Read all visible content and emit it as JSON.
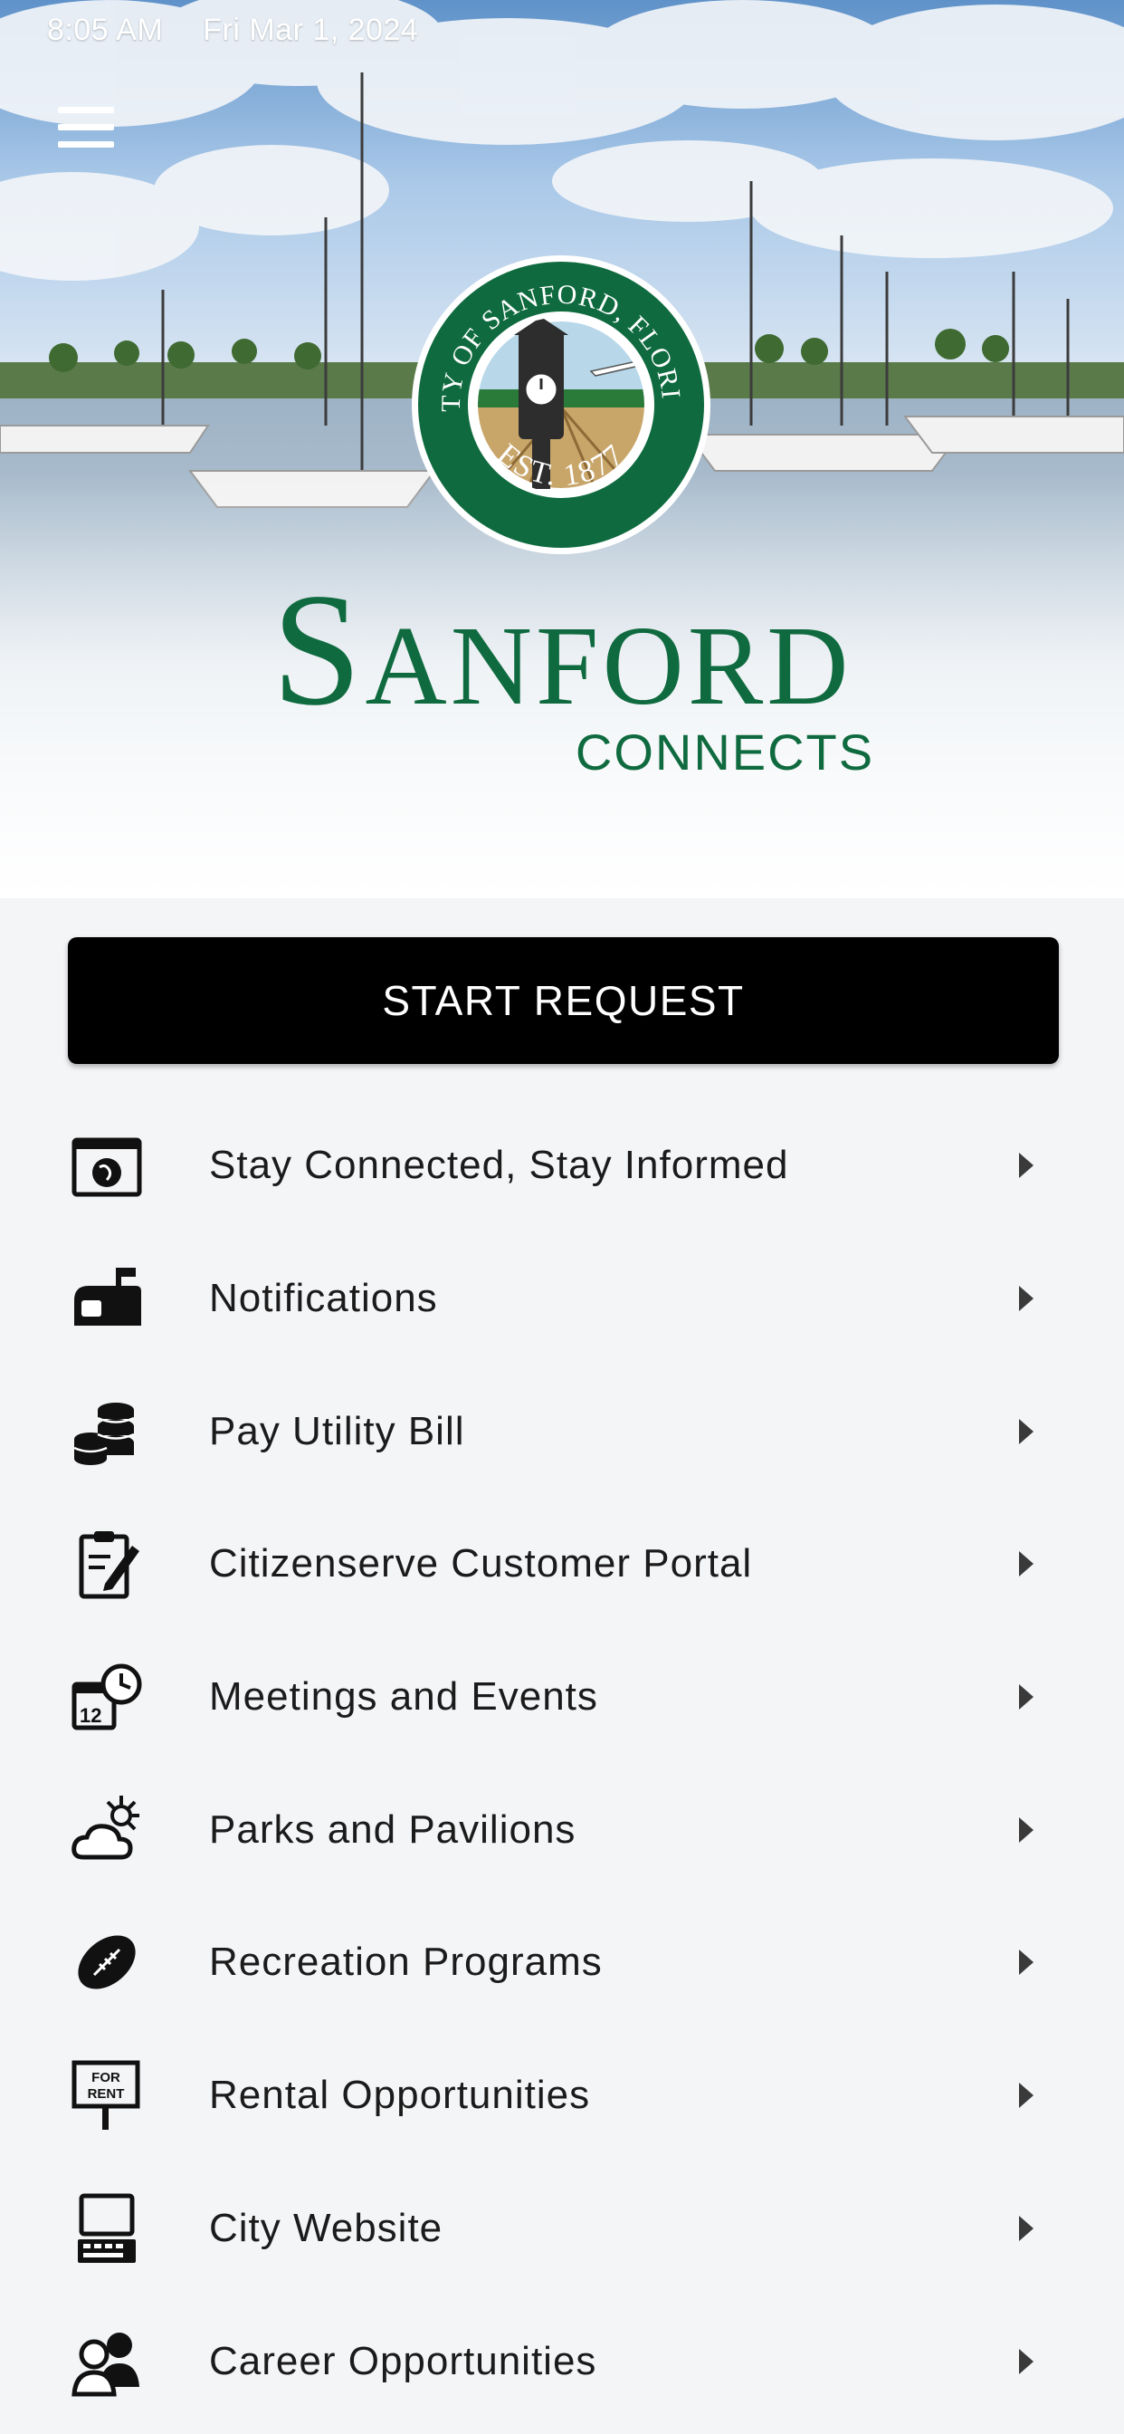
{
  "status_bar": {
    "time": "8:05 AM",
    "date": "Fri Mar 1, 2024"
  },
  "header": {
    "menu_icon": "hamburger-menu-icon",
    "seal_text_top": "CITY OF SANFORD, FLORIDA",
    "seal_text_bottom": "EST. 1877",
    "brand_name": "Sanford",
    "brand_sub": "CONNECTS",
    "brand_color": "#0f6b3f"
  },
  "start_request": {
    "label": "START REQUEST"
  },
  "menu": {
    "items": [
      {
        "label": "Stay Connected, Stay Informed",
        "icon": "globe-browser-icon"
      },
      {
        "label": "Notifications",
        "icon": "mailbox-icon"
      },
      {
        "label": "Pay Utility Bill",
        "icon": "coins-icon"
      },
      {
        "label": "Citizenserve Customer Portal",
        "icon": "clipboard-pen-icon"
      },
      {
        "label": "Meetings and Events",
        "icon": "calendar-clock-icon"
      },
      {
        "label": "Parks and Pavilions",
        "icon": "sun-cloud-icon"
      },
      {
        "label": "Recreation Programs",
        "icon": "football-icon"
      },
      {
        "label": "Rental Opportunities",
        "icon": "for-rent-sign-icon"
      },
      {
        "label": "City Website",
        "icon": "computer-icon"
      },
      {
        "label": "Career Opportunities",
        "icon": "people-icon"
      }
    ]
  }
}
